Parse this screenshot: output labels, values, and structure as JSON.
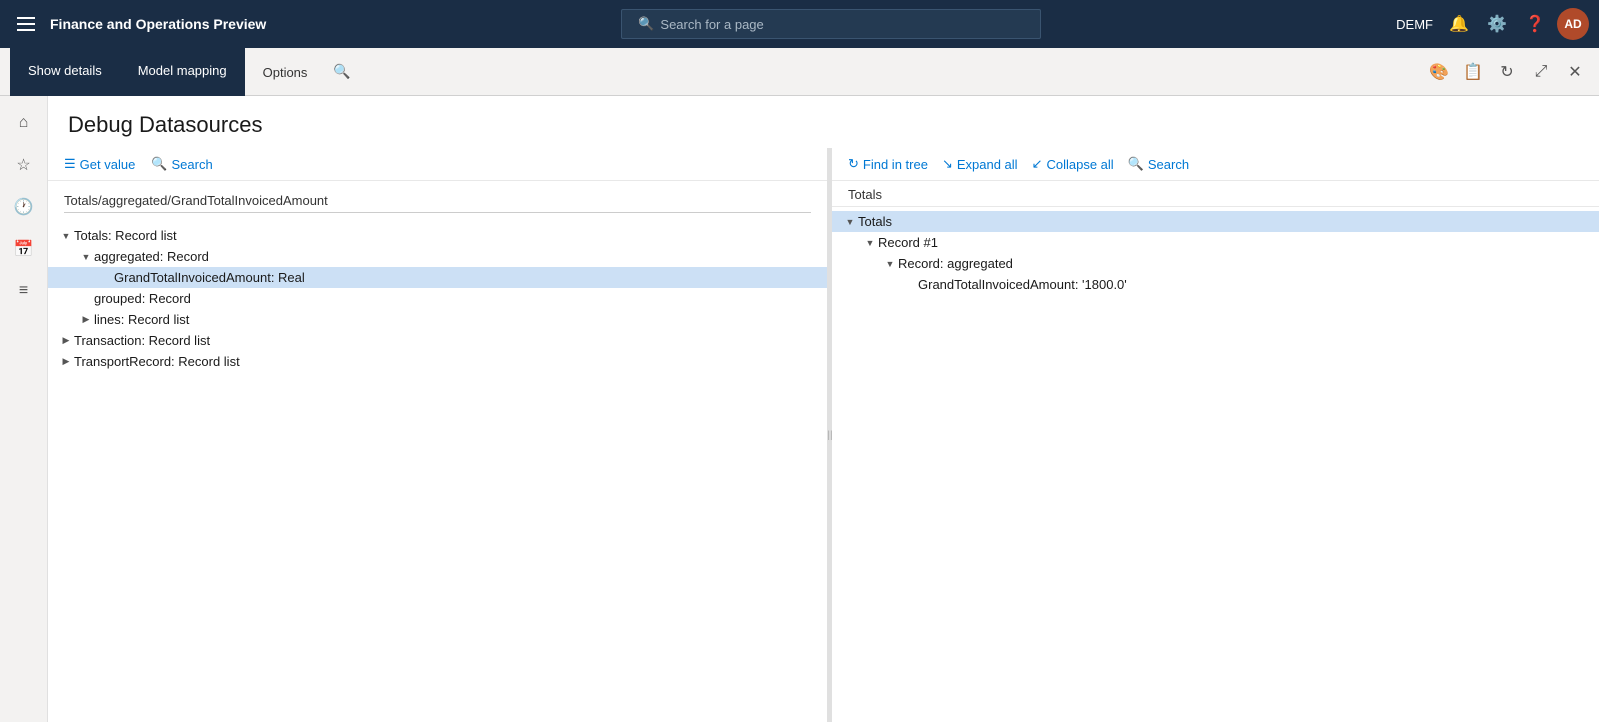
{
  "app": {
    "title": "Finance and Operations Preview"
  },
  "topnav": {
    "search_placeholder": "Search for a page",
    "user_name": "DEMF",
    "avatar_initials": "AD"
  },
  "toolbar": {
    "tabs": [
      {
        "id": "show-details",
        "label": "Show details",
        "state": "active"
      },
      {
        "id": "model-mapping",
        "label": "Model mapping",
        "state": "active"
      },
      {
        "id": "options",
        "label": "Options",
        "state": "plain"
      }
    ],
    "icons": [
      "palette",
      "layers",
      "refresh",
      "external",
      "close"
    ]
  },
  "sidebar": {
    "icons": [
      "home",
      "star",
      "clock",
      "calendar",
      "list"
    ]
  },
  "page": {
    "title": "Debug Datasources"
  },
  "left_panel": {
    "toolbar": {
      "get_value": "Get value",
      "search": "Search"
    },
    "path": "Totals/aggregated/GrandTotalInvoicedAmount",
    "tree": [
      {
        "id": "totals",
        "indent": 0,
        "toggle": "▼",
        "label": "Totals: Record list",
        "selected": false
      },
      {
        "id": "aggregated",
        "indent": 1,
        "toggle": "▼",
        "label": "aggregated: Record",
        "selected": false
      },
      {
        "id": "grand-total",
        "indent": 2,
        "toggle": "",
        "label": "GrandTotalInvoicedAmount: Real",
        "selected": true
      },
      {
        "id": "grouped",
        "indent": 1,
        "toggle": "",
        "label": "grouped: Record",
        "selected": false
      },
      {
        "id": "lines",
        "indent": 1,
        "toggle": "▶",
        "label": "lines: Record list",
        "selected": false
      },
      {
        "id": "transaction",
        "indent": 0,
        "toggle": "▶",
        "label": "Transaction: Record list",
        "selected": false
      },
      {
        "id": "transport",
        "indent": 0,
        "toggle": "▶",
        "label": "TransportRecord: Record list",
        "selected": false
      }
    ]
  },
  "right_panel": {
    "toolbar": {
      "find_in_tree": "Find in tree",
      "expand_all": "Expand all",
      "collapse_all": "Collapse all",
      "search": "Search"
    },
    "label": "Totals",
    "tree": [
      {
        "id": "r-totals",
        "indent": 0,
        "toggle": "▼",
        "label": "Totals",
        "selected": true
      },
      {
        "id": "r-record1",
        "indent": 1,
        "toggle": "▼",
        "label": "Record #1",
        "selected": false
      },
      {
        "id": "r-aggregated",
        "indent": 2,
        "toggle": "▼",
        "label": "Record: aggregated",
        "selected": false
      },
      {
        "id": "r-grand",
        "indent": 3,
        "toggle": "",
        "label": "GrandTotalInvoicedAmount: '1800.0'",
        "selected": false
      }
    ]
  }
}
